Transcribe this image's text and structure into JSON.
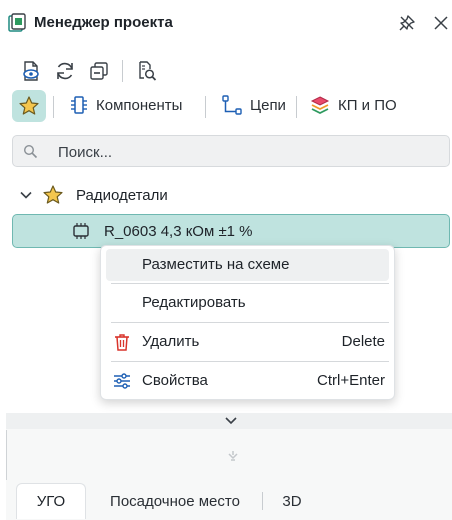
{
  "panel": {
    "title": "Менеджер проекта",
    "icons": {
      "title": "project-manager-icon",
      "pin": "pin-icon",
      "close": "close-icon"
    }
  },
  "toolbar": {
    "buttons": [
      {
        "name": "document-view-button",
        "icon": "document-eye-icon"
      },
      {
        "name": "refresh-button",
        "icon": "refresh-icon"
      },
      {
        "name": "collapse-button",
        "icon": "collapse-icon"
      },
      {
        "name": "find-in-document-button",
        "icon": "document-search-icon"
      }
    ]
  },
  "filters": {
    "favorites_icon": "star-icon",
    "items": [
      {
        "label": "Компоненты",
        "icon": "component-icon"
      },
      {
        "label": "Цепи",
        "icon": "net-icon"
      },
      {
        "label": "КП и ПО",
        "icon": "layers-icon"
      }
    ]
  },
  "search": {
    "placeholder": "Поиск...",
    "value": ""
  },
  "tree": {
    "group": {
      "label": "Радиодетали",
      "expanded": true
    },
    "item": {
      "label": "R_0603 4,3 кОм ±1 %",
      "selected": true
    }
  },
  "context_menu": {
    "items": [
      {
        "label": "Разместить на схеме",
        "shortcut": "",
        "icon": "",
        "highlighted": true
      },
      {
        "label": "Редактировать",
        "shortcut": "",
        "icon": ""
      },
      {
        "label": "Удалить",
        "shortcut": "Delete",
        "icon": "trash-icon"
      },
      {
        "label": "Свойства",
        "shortcut": "Ctrl+Enter",
        "icon": "properties-icon"
      }
    ]
  },
  "preview": {
    "tabs": [
      {
        "label": "УГО",
        "active": true
      },
      {
        "label": "Посадочное место",
        "active": false
      },
      {
        "label": "3D",
        "active": false
      }
    ]
  },
  "colors": {
    "accent": "#bfe3df",
    "accent_border": "#6fb8b1",
    "danger": "#d9342b",
    "icon_teal": "#1f8a80"
  }
}
